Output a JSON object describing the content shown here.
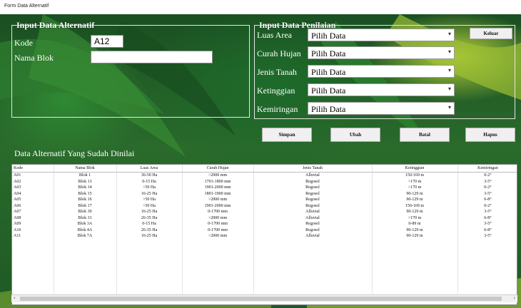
{
  "window": {
    "title": "Form Data Alternatif"
  },
  "input_alternatif": {
    "legend": "Input Data Alternatif",
    "kode_label": "Kode",
    "kode_value": "A12",
    "nama_label": "Nama Blok",
    "nama_value": ""
  },
  "input_penilaian": {
    "legend": "Input Data Penilaian",
    "fields": [
      {
        "label": "Luas Area",
        "value": "Pilih Data"
      },
      {
        "label": "Curah Hujan",
        "value": "Pilih Data"
      },
      {
        "label": "Jenis Tanah",
        "value": "Pilih Data"
      },
      {
        "label": "Ketinggian",
        "value": "Pilih Data"
      },
      {
        "label": "Kemiringan",
        "value": "Pilih Data"
      }
    ]
  },
  "buttons": {
    "keluar": "Keluar",
    "simpan": "Simpan",
    "ubah": "Ubah",
    "batal": "Batal",
    "hapus": "Hapus"
  },
  "table": {
    "title": "Data Alternatif Yang Sudah Dinilai",
    "columns": [
      "Kode",
      "Nama Blok",
      "Luas Area",
      "Curah Hujan",
      "Jenis Tanah",
      "Ketinggian",
      "Kemiringan"
    ],
    "rows": [
      [
        "A01",
        "Blok 1",
        "36-50 Ha",
        ">2000 mm",
        "Alluvial",
        "150-169 m",
        "0-2°"
      ],
      [
        "A02",
        "Blok 13",
        "0-15 Ha",
        "1701-1800 mm",
        "Regosol",
        ">170 m",
        "3-5°"
      ],
      [
        "A03",
        "Blok 14",
        ">50 Ha",
        "1901-2000 mm",
        "Regosol",
        ">170 m",
        "0-2°"
      ],
      [
        "A04",
        "Blok 15",
        "16-25 Ha",
        "1801-1900 mm",
        "Regosol",
        "90-129 m",
        "3-5°"
      ],
      [
        "A05",
        "Blok 16",
        ">50 Ha",
        ">2000 mm",
        "Regosol",
        "90-129 m",
        "6-8°"
      ],
      [
        "A06",
        "Blok 17",
        ">50 Ha",
        "1901-2000 mm",
        "Regosol",
        "150-169 m",
        "0-2°"
      ],
      [
        "A07",
        "Blok 30",
        "16-25 Ha",
        "0-1700 mm",
        "Alluvial",
        "90-129 m",
        "3-5°"
      ],
      [
        "A08",
        "Blok 31",
        "26-35 Ha",
        ">2000 mm",
        "Alluvial",
        ">170 m",
        "6-8°"
      ],
      [
        "A09",
        "Blok 3A",
        "0-15 Ha",
        "0-1700 mm",
        "Regosol",
        "0-89 m",
        "3-5°"
      ],
      [
        "A10",
        "Blok 4A",
        "26-35 Ha",
        "0-1700 mm",
        "Regosol",
        "90-129 m",
        "6-8°"
      ],
      [
        "A11",
        "Blok 7A",
        "16-25 Ha",
        ">2000 mm",
        "Alluvial",
        "90-129 m",
        "3-5°"
      ]
    ]
  },
  "colors": {
    "background": "#1f5a24",
    "leaf_light": "#b9d33a"
  },
  "icons": {
    "dropdown": "chevron-down-icon",
    "scroll_left": "arrow-left-icon",
    "scroll_right": "arrow-right-icon"
  }
}
